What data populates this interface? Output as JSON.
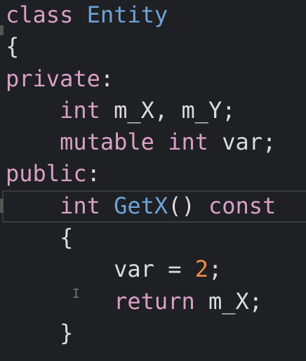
{
  "editor": {
    "colors": {
      "background": "#1f2023",
      "keyword": "#d8a0c8",
      "type": "#6fa3d8",
      "number": "#f08d49",
      "text": "#dcdcdc"
    },
    "current_line": 7,
    "lines": [
      [
        [
          "class",
          "kw"
        ],
        [
          " ",
          "plain"
        ],
        [
          "Entity",
          "type"
        ]
      ],
      [
        [
          "{",
          "plain"
        ]
      ],
      [
        [
          "private",
          "kw"
        ],
        [
          ":",
          "plain"
        ]
      ],
      [
        [
          "    ",
          "plain"
        ],
        [
          "int",
          "kw"
        ],
        [
          " m_X, m_Y;",
          "plain"
        ]
      ],
      [
        [
          "    ",
          "plain"
        ],
        [
          "mutable",
          "kw"
        ],
        [
          " ",
          "plain"
        ],
        [
          "int",
          "kw"
        ],
        [
          " var;",
          "plain"
        ]
      ],
      [
        [
          "public",
          "kw"
        ],
        [
          ":",
          "plain"
        ]
      ],
      [
        [
          "    ",
          "plain"
        ],
        [
          "int",
          "kw"
        ],
        [
          " ",
          "plain"
        ],
        [
          "GetX",
          "fn"
        ],
        [
          "() ",
          "plain"
        ],
        [
          "const",
          "kw"
        ]
      ],
      [
        [
          "    {",
          "plain"
        ]
      ],
      [
        [
          "        var = ",
          "plain"
        ],
        [
          "2",
          "num"
        ],
        [
          ";",
          "plain"
        ]
      ],
      [
        [
          "        ",
          "plain"
        ],
        [
          "return",
          "kw"
        ],
        [
          " m_X;",
          "plain"
        ]
      ],
      [
        [
          "    }",
          "plain"
        ]
      ]
    ]
  }
}
